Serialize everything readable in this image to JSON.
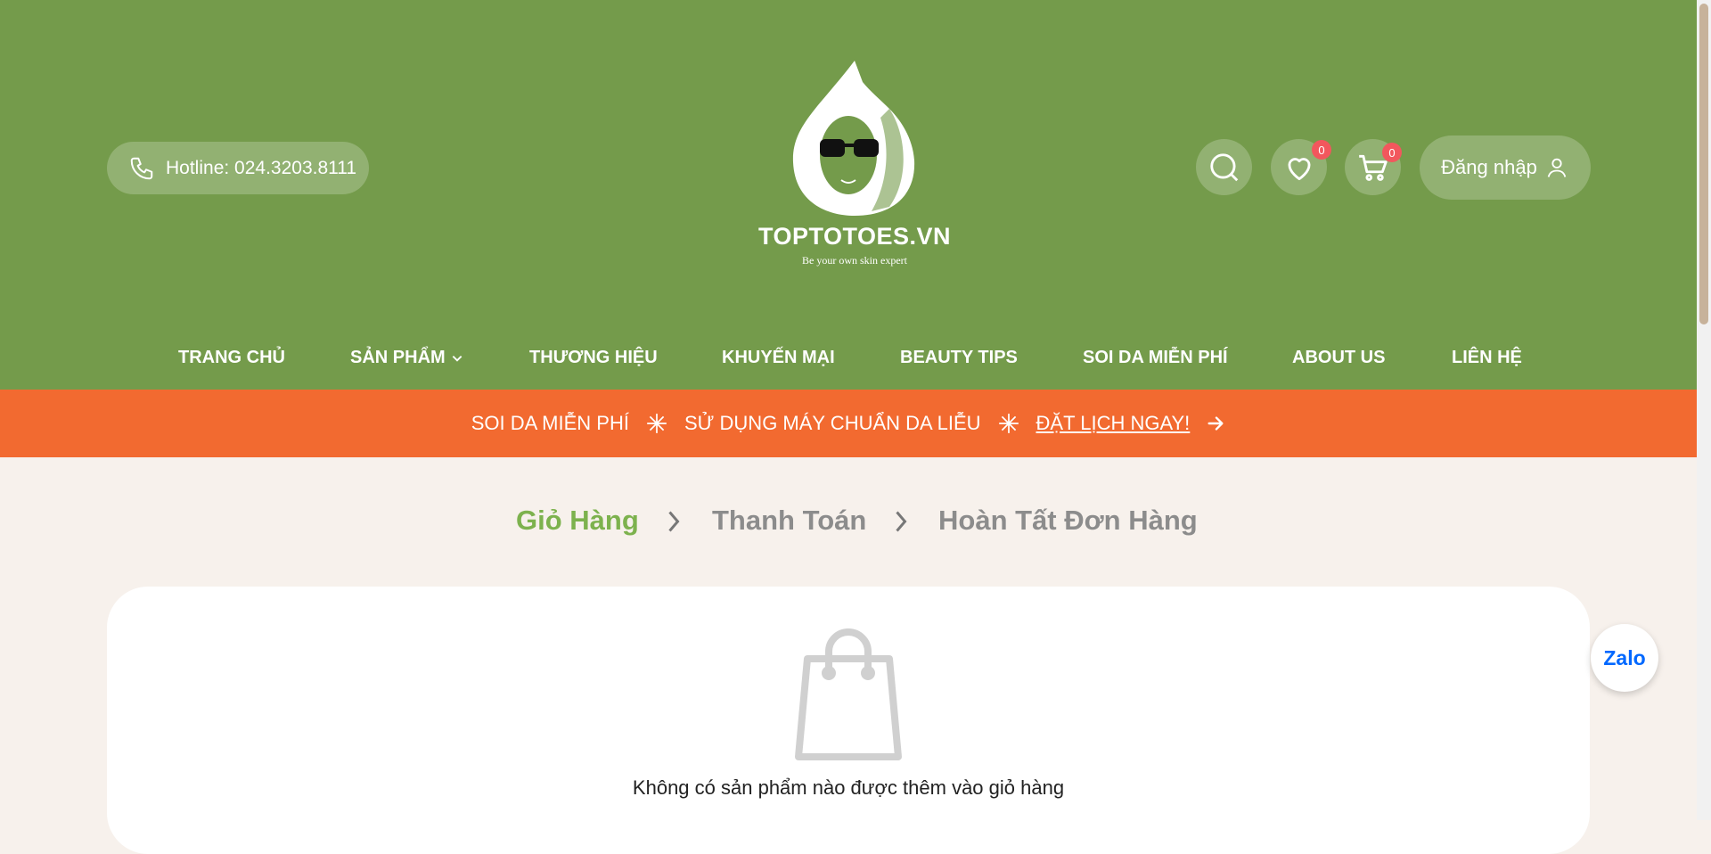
{
  "header": {
    "hotline": "Hotline: 024.3203.8111",
    "logo_text": "TOPTOTOES.VN",
    "logo_tagline": "Be your own skin expert",
    "wishlist_count": "0",
    "cart_count": "0",
    "login_label": "Đăng nhập"
  },
  "nav": {
    "items": [
      {
        "label": "TRANG CHỦ"
      },
      {
        "label": "SẢN PHẨM"
      },
      {
        "label": "THƯƠNG HIỆU"
      },
      {
        "label": "KHUYẾN MẠI"
      },
      {
        "label": "BEAUTY TIPS"
      },
      {
        "label": "SOI DA MIỄN PHÍ"
      },
      {
        "label": "ABOUT US"
      },
      {
        "label": "LIÊN HỆ"
      }
    ]
  },
  "promo": {
    "part1": "SOI DA MIỄN PHÍ",
    "part2": "SỬ DỤNG MÁY CHUẨN DA LIỄU",
    "cta": "ĐẶT LỊCH NGAY!"
  },
  "checkout_steps": [
    {
      "label": "Giỏ Hàng",
      "active": true
    },
    {
      "label": "Thanh Toán",
      "active": false
    },
    {
      "label": "Hoàn Tất Đơn Hàng",
      "active": false
    }
  ],
  "cart": {
    "empty_message": "Không có sản phẩm nào được thêm vào giỏ hàng"
  },
  "zalo_label": "Zalo",
  "colors": {
    "header_bg": "#749b4b",
    "promo_bg": "#f26a30",
    "active_step": "#7db24e",
    "badge": "#f2575d",
    "page_bg": "#f7f1ec"
  }
}
